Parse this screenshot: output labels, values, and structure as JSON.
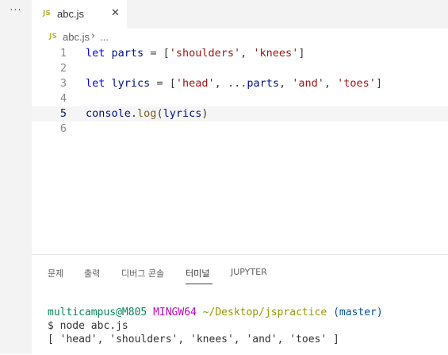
{
  "activity": {
    "more_label": "···"
  },
  "tab": {
    "icon_label": "JS",
    "filename": "abc.js",
    "close_label": "✕"
  },
  "breadcrumb": {
    "icon_label": "JS",
    "file": "abc.js",
    "separator": "›",
    "ellipsis": "..."
  },
  "editor": {
    "line_numbers": [
      "1",
      "2",
      "3",
      "4",
      "5",
      "6"
    ],
    "active_line": 5
  },
  "panel": {
    "tabs": [
      {
        "label": "문제"
      },
      {
        "label": "출력"
      },
      {
        "label": "디버그 콘솔"
      },
      {
        "label": "터미널"
      },
      {
        "label": "JUPYTER"
      }
    ],
    "active_tab": "터미널"
  },
  "terminal": {
    "prompt_user": "multicampus@M805",
    "prompt_env": "MINGW64",
    "prompt_path": "~/Desktop/jspractice",
    "prompt_branch": "(master)",
    "command": "$ node abc.js",
    "output": "[ 'head', 'shoulders', 'knees', 'and', 'toes' ]"
  },
  "colors": {
    "keyword": "#0000ff",
    "variable": "#001080",
    "string": "#a31515",
    "function": "#795e26",
    "js_icon": "#b7b73b"
  }
}
